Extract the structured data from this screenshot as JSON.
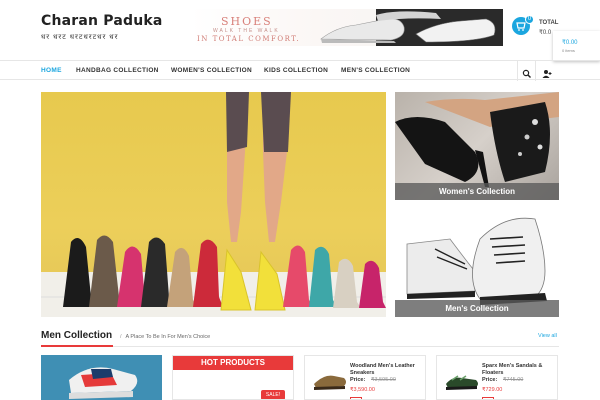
{
  "brand": {
    "title": "Charan Paduka",
    "tagline": "धर धरट धरटधरटधर धर"
  },
  "banner": {
    "title": "SHOES",
    "line1": "WALK THE WALK",
    "line2": "IN TOTAL COMFORT."
  },
  "cart": {
    "count": "0",
    "total_label": "TOTAL",
    "total_value": "₹0.0",
    "dropdown_price": "₹0.00",
    "dropdown_items": "0 items"
  },
  "nav": {
    "items": [
      {
        "label": "HOME",
        "active": true
      },
      {
        "label": "HANDBAG COLLECTION"
      },
      {
        "label": "WOMEN'S COLLECTION"
      },
      {
        "label": "KIDS COLLECTION"
      },
      {
        "label": "MEN'S COLLECTION"
      }
    ],
    "search_icon": "search-icon",
    "user_icon": "user-add-icon"
  },
  "hero": {
    "women_caption": "Women's Collection",
    "men_caption": "Men's Collection"
  },
  "section": {
    "title": "Men Collection",
    "subtitle": "A Place To Be In For Men's Choice",
    "view_all": "View all"
  },
  "hot": {
    "title": "HOT PRODUCTS",
    "badge": "SALE!"
  },
  "products": [
    {
      "name": "Woodland Men's Leather Sneakers",
      "price_label": "Price:",
      "old_price": "₹3,595.00",
      "new_price": "₹3,590.00"
    },
    {
      "name": "Sparx Men's Sandals & Floaters",
      "price_label": "Price:",
      "old_price": "₹745.00",
      "new_price": "₹729.00"
    }
  ],
  "colors": {
    "accent": "#1ba6df",
    "red": "#e83a3a"
  }
}
